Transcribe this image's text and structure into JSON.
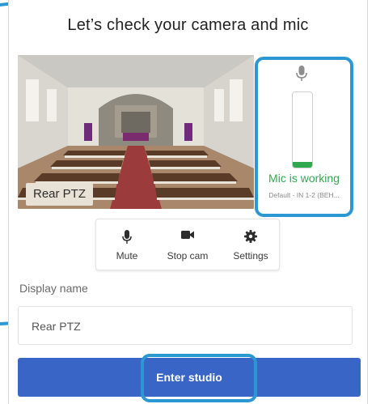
{
  "dialog": {
    "title": "Let’s check your camera and mic"
  },
  "camera": {
    "source_label": "Rear PTZ"
  },
  "mic": {
    "icon": "microphone-icon",
    "level": 0.08,
    "status": "Mic is working",
    "device": "Default - IN 1-2 (BEH...",
    "status_color": "#33a852"
  },
  "toolbar": {
    "mute": {
      "label": "Mute",
      "icon": "microphone-icon"
    },
    "stop_cam": {
      "label": "Stop cam",
      "icon": "video-camera-icon"
    },
    "settings": {
      "label": "Settings",
      "icon": "gear-icon"
    }
  },
  "display_name": {
    "label": "Display name",
    "value": "Rear PTZ"
  },
  "enter_button": {
    "label": "Enter studio",
    "color": "#3966c6"
  },
  "highlight_color": "#2b98d3"
}
